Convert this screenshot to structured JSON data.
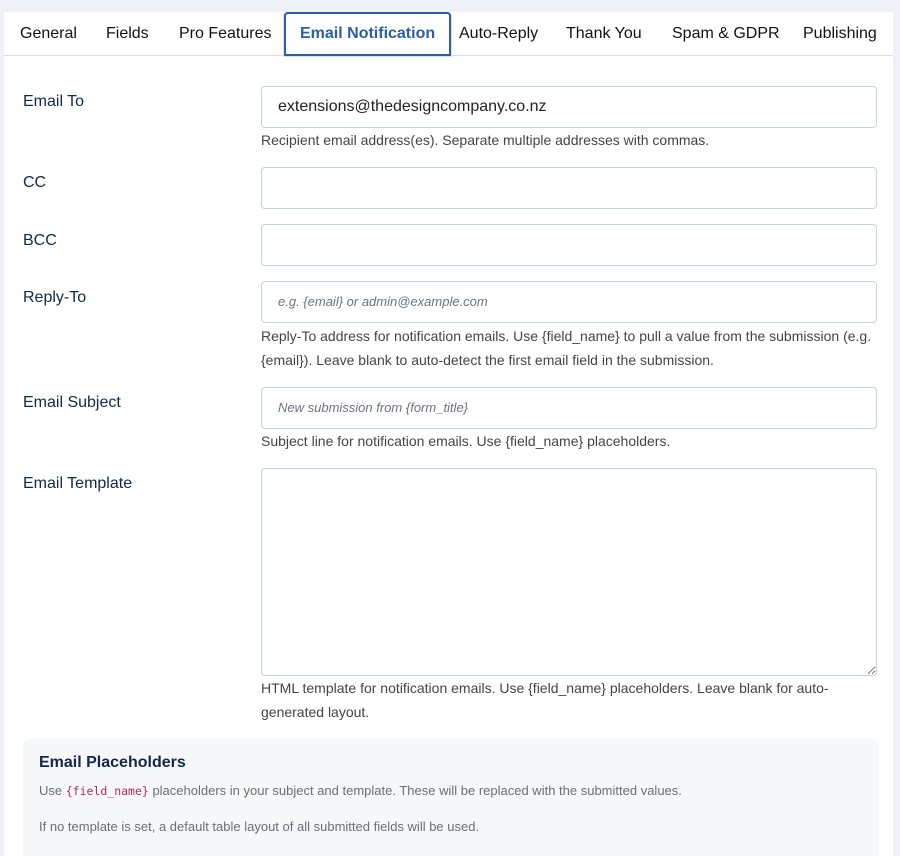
{
  "tabs": [
    {
      "label": "General"
    },
    {
      "label": "Fields"
    },
    {
      "label": "Pro Features"
    },
    {
      "label": "Email Notification",
      "active": true
    },
    {
      "label": "Auto-Reply"
    },
    {
      "label": "Thank You"
    },
    {
      "label": "Spam & GDPR"
    },
    {
      "label": "Publishing"
    }
  ],
  "fields": {
    "email_to": {
      "label": "Email To",
      "value": "extensions@thedesigncompany.co.nz",
      "help": "Recipient email address(es). Separate multiple addresses with commas."
    },
    "cc": {
      "label": "CC",
      "value": ""
    },
    "bcc": {
      "label": "BCC",
      "value": ""
    },
    "reply_to": {
      "label": "Reply-To",
      "value": "",
      "placeholder": "e.g. {email} or admin@example.com",
      "help": "Reply-To address for notification emails. Use {field_name} to pull a value from the submission (e.g. {email}). Leave blank to auto-detect the first email field in the submission."
    },
    "subject": {
      "label": "Email Subject",
      "value": "",
      "placeholder": "New submission from {form_title}",
      "help": "Subject line for notification emails. Use {field_name} placeholders."
    },
    "template": {
      "label": "Email Template",
      "value": "",
      "help": "HTML template for notification emails. Use {field_name} placeholders. Leave blank for auto-generated layout."
    }
  },
  "placeholders_info": {
    "title": "Email Placeholders",
    "line1_pre": "Use ",
    "line1_code": "{field_name}",
    "line1_post": " placeholders in your subject and template. These will be replaced with the submitted values.",
    "line2": "If no template is set, a default table layout of all submitted fields will be used."
  },
  "colors": {
    "accent": "#2a5fa8",
    "label": "#12284a",
    "code": "#b52a5b"
  }
}
